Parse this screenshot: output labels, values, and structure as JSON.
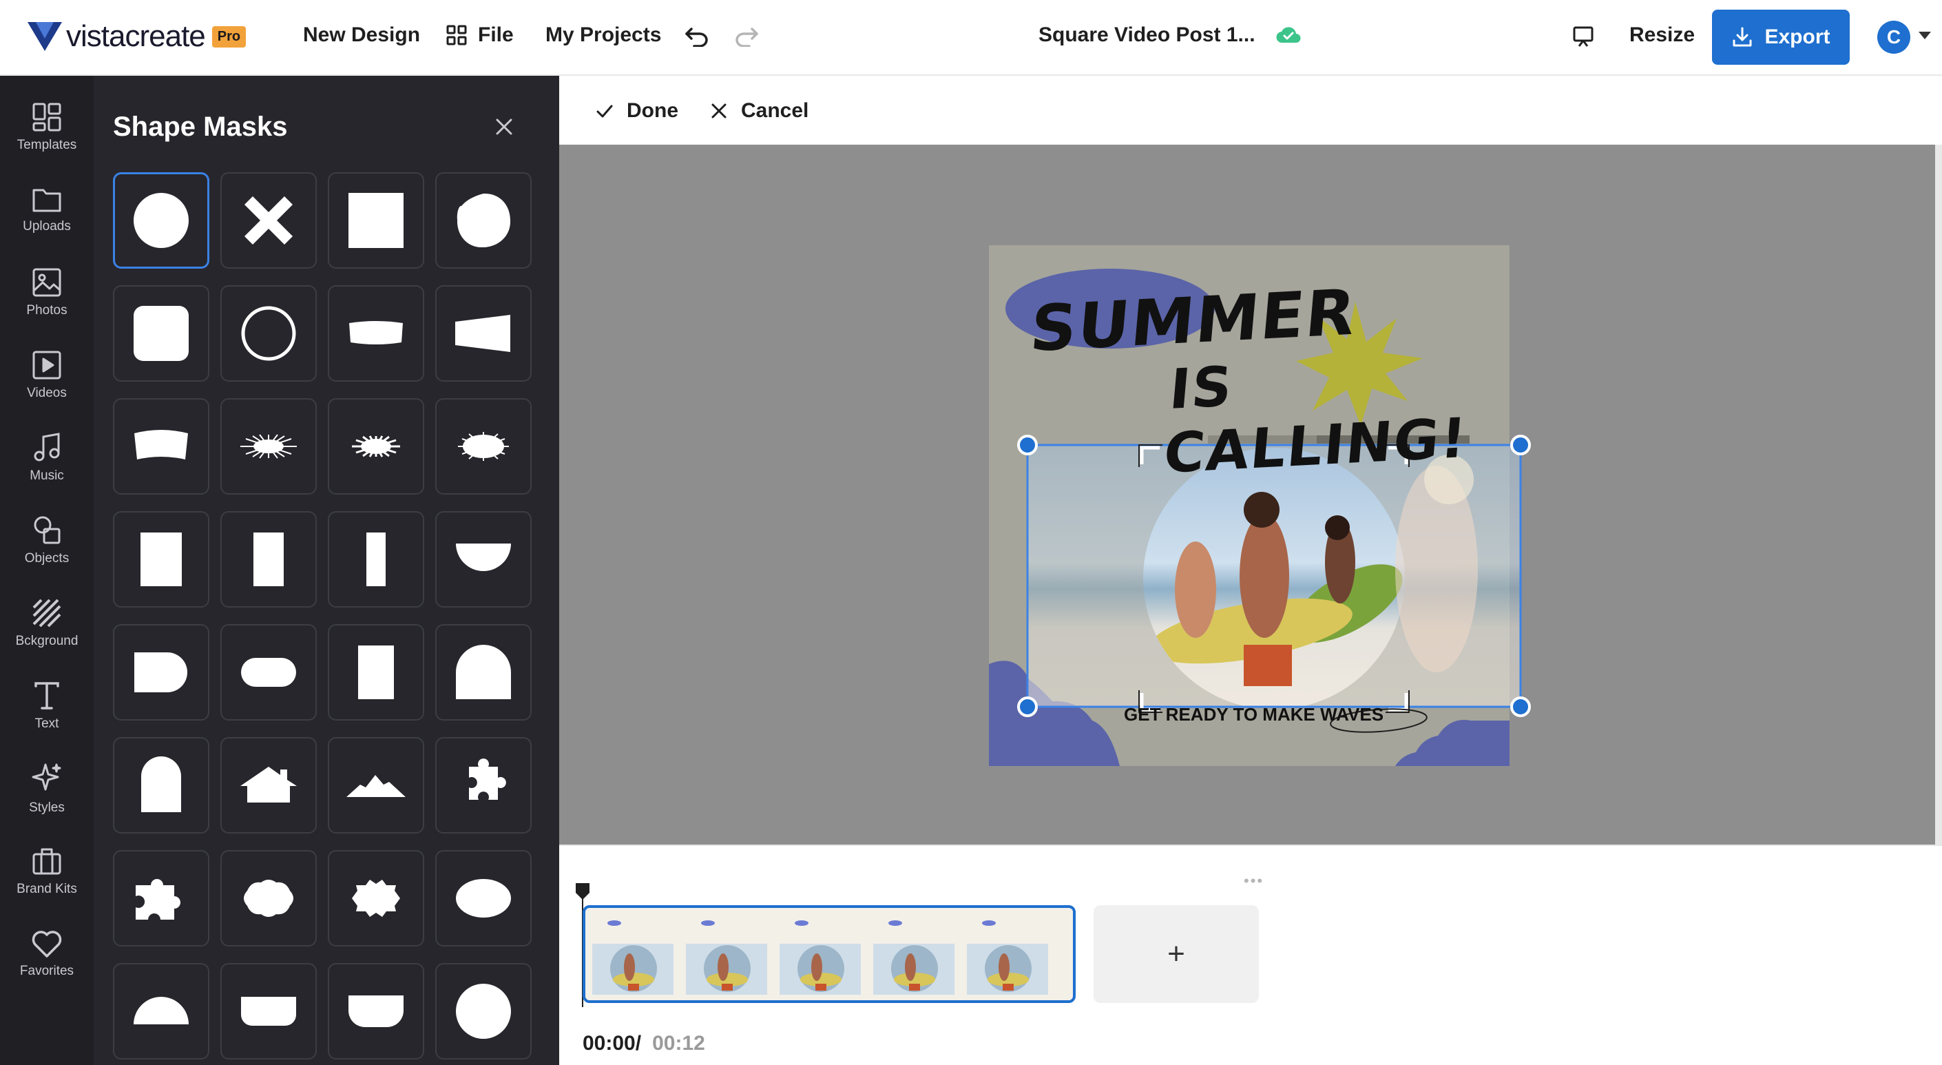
{
  "header": {
    "brand": "vistacreate",
    "pro_badge": "Pro",
    "new_design": "New Design",
    "file": "File",
    "my_projects": "My Projects",
    "doc_title": "Square Video Post 1...",
    "resize": "Resize",
    "export": "Export",
    "avatar_initial": "C"
  },
  "rail": {
    "items": [
      {
        "label": "Templates",
        "icon": "templates-icon"
      },
      {
        "label": "Uploads",
        "icon": "folder-icon"
      },
      {
        "label": "Photos",
        "icon": "photo-icon"
      },
      {
        "label": "Videos",
        "icon": "video-icon"
      },
      {
        "label": "Music",
        "icon": "music-note-icon"
      },
      {
        "label": "Objects",
        "icon": "objects-icon"
      },
      {
        "label": "Bckground",
        "icon": "background-icon"
      },
      {
        "label": "Text",
        "icon": "text-icon"
      },
      {
        "label": "Styles",
        "icon": "sparkle-icon"
      },
      {
        "label": "Brand Kits",
        "icon": "briefcase-icon"
      },
      {
        "label": "Favorites",
        "icon": "heart-icon"
      }
    ]
  },
  "panel": {
    "title": "Shape Masks",
    "masks": [
      "circle",
      "cross",
      "square",
      "blob-circle",
      "rounded-square",
      "ring",
      "wavy-banner",
      "trapezoid",
      "curved-banner",
      "starburst-thin",
      "starburst",
      "starburst-oval",
      "rectangle-wide",
      "rectangle-medium",
      "rectangle-thin",
      "half-circle-bottom",
      "d-shape",
      "pill",
      "rectangle-tall",
      "arch",
      "arch-tall",
      "house",
      "mountains",
      "puzzle-piece",
      "puzzle-piece-2",
      "scalloped-oval",
      "badge-oval",
      "oval",
      "half-circle-top",
      "rounded-bottom",
      "cup",
      "circle-2"
    ],
    "selected_index": 0
  },
  "edit_bar": {
    "done": "Done",
    "cancel": "Cancel"
  },
  "design": {
    "headline_1": "SUMMER",
    "headline_2": "IS CALLING!",
    "tagline": "GET READY TO MAKE WAVES"
  },
  "timeline": {
    "current_time": "00:00/",
    "total_time": "00:12",
    "add_label": "+"
  },
  "colors": {
    "accent": "#1e6fcf",
    "panel_bg": "#26262c",
    "rail_bg": "#1f1f24",
    "stage_bg": "#8e8e8e",
    "canvas_bg": "#a5a59b",
    "purple": "#5b64a8",
    "olive": "#b5b23a"
  }
}
